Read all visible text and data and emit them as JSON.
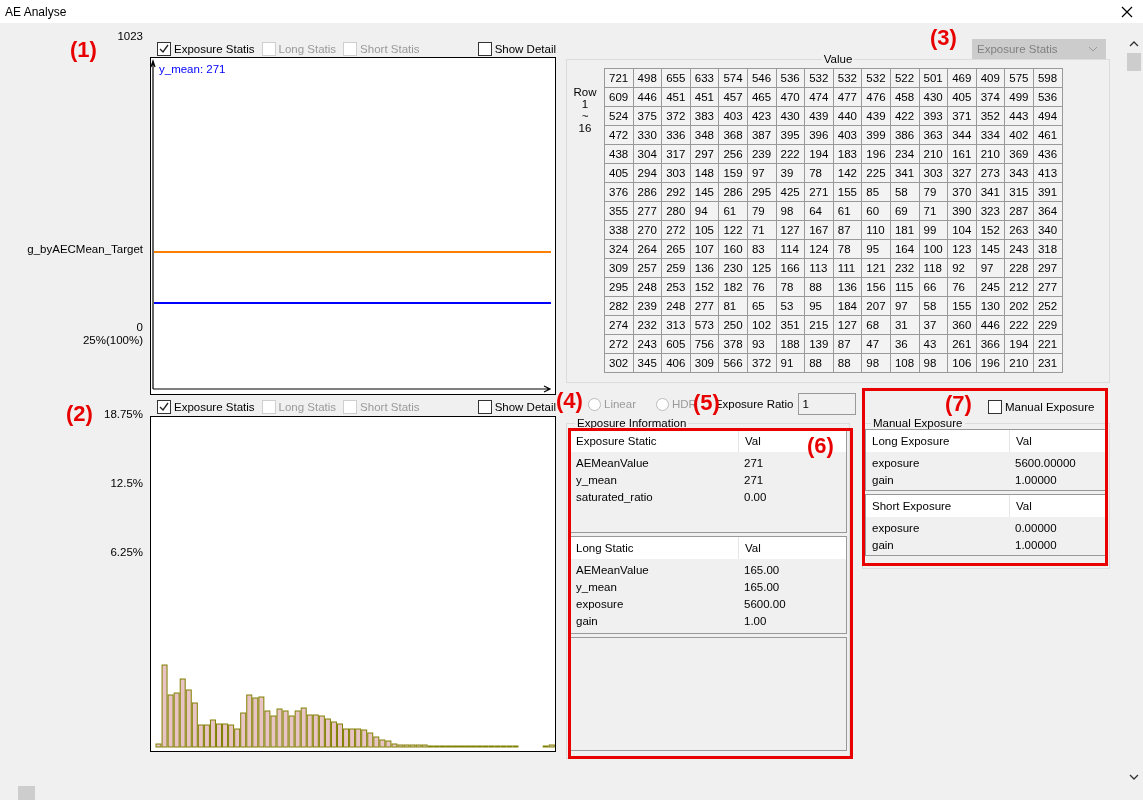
{
  "window": {
    "title": "AE Analyse"
  },
  "annotations": [
    {
      "label": "(1)"
    },
    {
      "label": "(2)"
    },
    {
      "label": "(3)"
    },
    {
      "label": "(4)"
    },
    {
      "label": "(5)"
    },
    {
      "label": "(6)"
    },
    {
      "label": "(7)"
    }
  ],
  "trend_chart": {
    "filters": [
      {
        "label": "Exposure Statis",
        "checked": true,
        "disabled": false
      },
      {
        "label": "Long Statis",
        "checked": false,
        "disabled": true
      },
      {
        "label": "Short Statis",
        "checked": false,
        "disabled": true
      }
    ],
    "show_detail": {
      "label": "Show Detail",
      "checked": false
    },
    "axis_labels": [
      "1023",
      "g_byAECMean_Target",
      "0",
      "25%(100%)"
    ],
    "legend": "y_mean: 271"
  },
  "histogram": {
    "filters": [
      {
        "label": "Exposure Statis",
        "checked": true,
        "disabled": false
      },
      {
        "label": "Long Statis",
        "checked": false,
        "disabled": true
      },
      {
        "label": "Short Statis",
        "checked": false,
        "disabled": true
      }
    ],
    "show_detail": {
      "label": "Show Detail",
      "checked": false
    },
    "axis_labels": [
      "18.75%",
      "12.5%",
      "6.25%"
    ]
  },
  "mode_select": {
    "value": "Exposure Statis",
    "disabled": true
  },
  "value_grid": {
    "title": "Value",
    "row_label": "Row 1 ~ 16",
    "rows": [
      [
        "721",
        "498",
        "655",
        "633",
        "574",
        "546",
        "536",
        "532",
        "532",
        "532",
        "522",
        "501",
        "469",
        "409",
        "575",
        "598"
      ],
      [
        "609",
        "446",
        "451",
        "451",
        "457",
        "465",
        "470",
        "474",
        "477",
        "476",
        "458",
        "430",
        "405",
        "374",
        "499",
        "536"
      ],
      [
        "524",
        "375",
        "372",
        "383",
        "403",
        "423",
        "430",
        "439",
        "440",
        "439",
        "422",
        "393",
        "371",
        "352",
        "443",
        "494"
      ],
      [
        "472",
        "330",
        "336",
        "348",
        "368",
        "387",
        "395",
        "396",
        "403",
        "399",
        "386",
        "363",
        "344",
        "334",
        "402",
        "461"
      ],
      [
        "438",
        "304",
        "317",
        "297",
        "256",
        "239",
        "222",
        "194",
        "183",
        "196",
        "234",
        "210",
        "161",
        "210",
        "369",
        "436"
      ],
      [
        "405",
        "294",
        "303",
        "148",
        "159",
        "97",
        "39",
        "78",
        "142",
        "225",
        "341",
        "303",
        "327",
        "273",
        "343",
        "413"
      ],
      [
        "376",
        "286",
        "292",
        "145",
        "286",
        "295",
        "425",
        "271",
        "155",
        "85",
        "58",
        "79",
        "370",
        "341",
        "315",
        "391"
      ],
      [
        "355",
        "277",
        "280",
        "94",
        "61",
        "79",
        "98",
        "64",
        "61",
        "60",
        "69",
        "71",
        "390",
        "323",
        "287",
        "364"
      ],
      [
        "338",
        "270",
        "272",
        "105",
        "122",
        "71",
        "127",
        "167",
        "87",
        "110",
        "181",
        "99",
        "104",
        "152",
        "263",
        "340"
      ],
      [
        "324",
        "264",
        "265",
        "107",
        "160",
        "83",
        "114",
        "124",
        "78",
        "95",
        "164",
        "100",
        "123",
        "145",
        "243",
        "318"
      ],
      [
        "309",
        "257",
        "259",
        "136",
        "230",
        "125",
        "166",
        "113",
        "111",
        "121",
        "232",
        "118",
        "92",
        "97",
        "228",
        "297"
      ],
      [
        "295",
        "248",
        "253",
        "152",
        "182",
        "76",
        "78",
        "88",
        "136",
        "156",
        "115",
        "66",
        "76",
        "245",
        "212",
        "277"
      ],
      [
        "282",
        "239",
        "248",
        "277",
        "81",
        "65",
        "53",
        "95",
        "184",
        "207",
        "97",
        "58",
        "155",
        "130",
        "202",
        "252"
      ],
      [
        "274",
        "232",
        "313",
        "573",
        "250",
        "102",
        "351",
        "215",
        "127",
        "68",
        "31",
        "37",
        "360",
        "446",
        "222",
        "229"
      ],
      [
        "272",
        "243",
        "605",
        "756",
        "378",
        "93",
        "188",
        "139",
        "87",
        "47",
        "36",
        "43",
        "261",
        "366",
        "194",
        "221"
      ],
      [
        "302",
        "345",
        "406",
        "309",
        "566",
        "372",
        "91",
        "88",
        "88",
        "98",
        "108",
        "98",
        "106",
        "196",
        "210",
        "231"
      ]
    ]
  },
  "mode": {
    "options": [
      {
        "label": "Linear",
        "selected": false,
        "disabled": true
      },
      {
        "label": "HDR",
        "selected": false,
        "disabled": true
      }
    ],
    "ratio": {
      "label": "Exposure Ratio",
      "value": "1"
    }
  },
  "exposure_information": {
    "title": "Exposure Information",
    "tables": [
      {
        "header": [
          "Exposure Static",
          "Val"
        ],
        "rows": [
          [
            "AEMeanValue",
            "271"
          ],
          [
            "y_mean",
            "271"
          ],
          [
            "saturated_ratio",
            "0.00"
          ]
        ]
      },
      {
        "header": [
          "Long Static",
          "Val"
        ],
        "rows": [
          [
            "AEMeanValue",
            "165.00"
          ],
          [
            "y_mean",
            "165.00"
          ],
          [
            "exposure",
            "5600.00"
          ],
          [
            "gain",
            "1.00"
          ]
        ]
      }
    ]
  },
  "manual_exposure": {
    "title": "Manual Exposure",
    "toggle": {
      "label": "Manual Exposure",
      "checked": false
    },
    "tables": [
      {
        "header": [
          "Long Exposure",
          "Val"
        ],
        "rows": [
          [
            "exposure",
            "5600.00000"
          ],
          [
            "gain",
            "1.00000"
          ]
        ]
      },
      {
        "header": [
          "Short Exposure",
          "Val"
        ],
        "rows": [
          [
            "exposure",
            "0.00000"
          ],
          [
            "gain",
            "1.00000"
          ]
        ]
      }
    ]
  }
}
